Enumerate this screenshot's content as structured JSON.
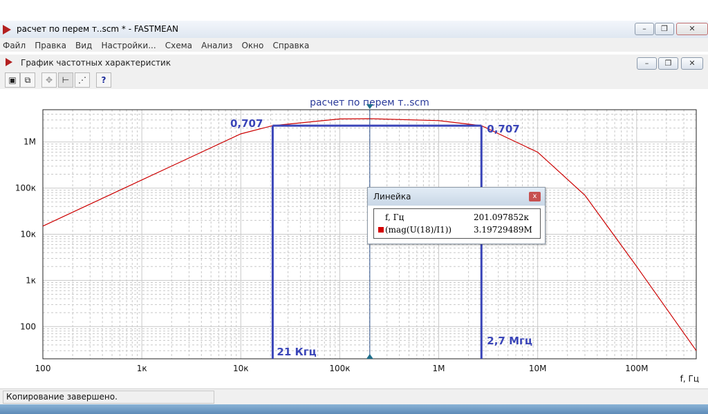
{
  "window": {
    "title": "расчет по перем т..scm * - FASTMEAN"
  },
  "menu": {
    "items": [
      "Файл",
      "Правка",
      "Вид",
      "Настройки...",
      "Схема",
      "Анализ",
      "Окно",
      "Справка"
    ]
  },
  "child_window": {
    "title": "График частотных характеристик"
  },
  "toolbar": {
    "icons": [
      "save-icon",
      "copy-icon",
      "move-icon",
      "ruler-icon",
      "curve-icon",
      "help-icon"
    ],
    "help_label": "?"
  },
  "ruler": {
    "title": "Линейка",
    "close_label": "x",
    "x_label": "f, Гц",
    "x_value": "201.097852к",
    "series_label": "(mag(U(18)/I1))",
    "series_value": "3.19729489М"
  },
  "annotations": {
    "left_level": "0,707",
    "right_level": "0,707",
    "low_freq": "21 Кгц",
    "high_freq": "2,7 Мгц"
  },
  "chart_data": {
    "type": "line",
    "title": "расчет по перем т..scm",
    "xlabel": "f, Гц",
    "ylabel": "",
    "xscale": "log",
    "yscale": "log",
    "xlim": [
      100,
      400000000
    ],
    "ylim": [
      20,
      5000000
    ],
    "x_ticks": [
      100,
      1000,
      10000,
      100000,
      1000000,
      10000000,
      100000000
    ],
    "x_tick_labels": [
      "100",
      "1к",
      "10к",
      "100к",
      "1М",
      "10М",
      "100М"
    ],
    "y_ticks": [
      100,
      1000,
      10000,
      100000,
      1000000
    ],
    "y_tick_labels": [
      "100",
      "1к",
      "10к",
      "100к",
      "1М"
    ],
    "grid": true,
    "series": [
      {
        "color": "#cc0000",
        "x": [
          100,
          1000,
          10000,
          21000,
          100000,
          201097.852,
          1000000,
          2700000,
          10000000,
          30000000,
          100000000,
          400000000
        ],
        "y": [
          15000,
          150000,
          1500000,
          2260000,
          3150000,
          3197294.89,
          2900000,
          2260000,
          600000,
          70000,
          2000,
          30
        ]
      }
    ],
    "cursor_x": 201097.852,
    "markers": [
      {
        "x": 21000,
        "label_bottom": "21 Кгц"
      },
      {
        "x": 2700000,
        "label_bottom": "2,7 Мгц"
      }
    ],
    "level_y": 2260000
  },
  "status": {
    "text": "Копирование завершено."
  },
  "colors": {
    "curve": "#cc0000",
    "annotation": "#3a45b8",
    "grid": "#c8c8c8"
  }
}
